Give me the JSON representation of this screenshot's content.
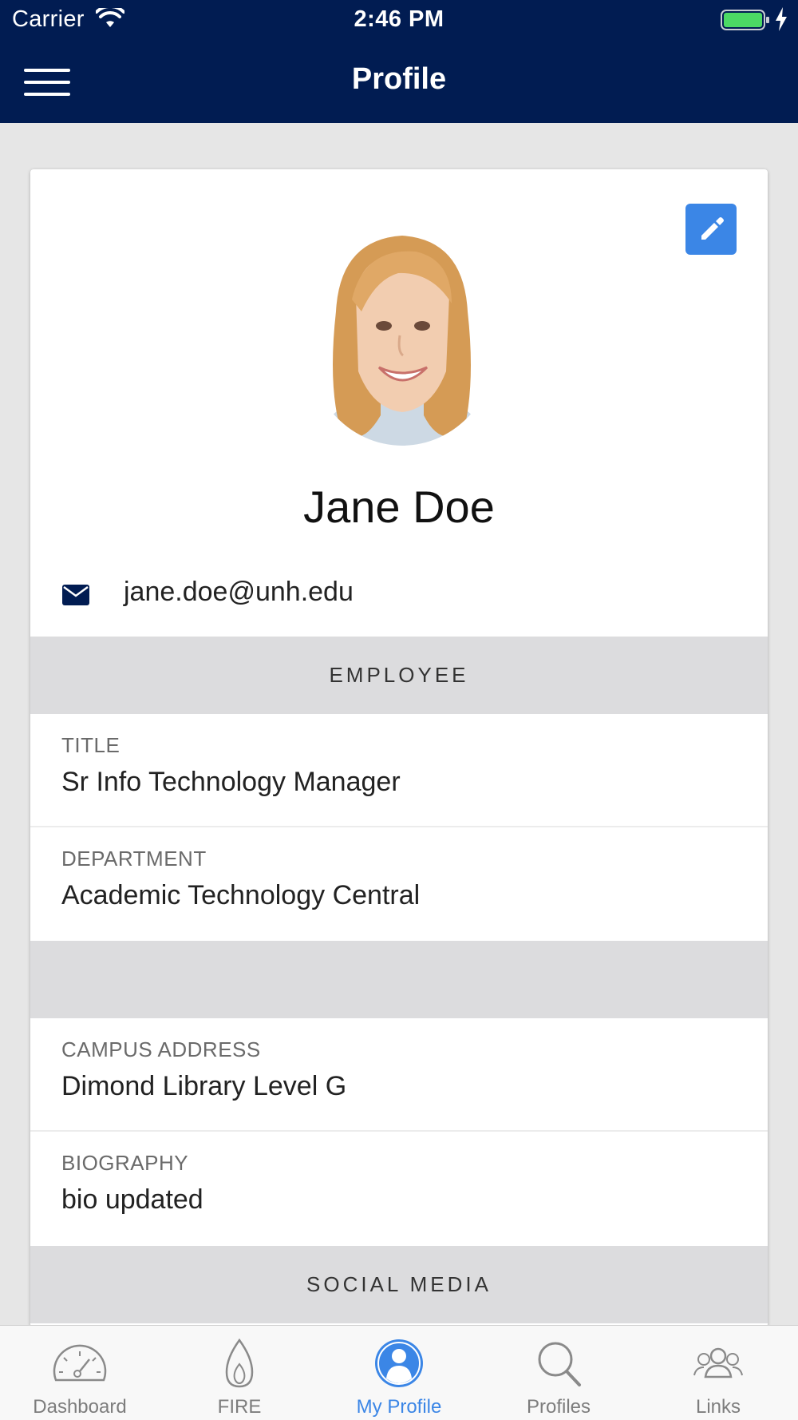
{
  "status_bar": {
    "carrier": "Carrier",
    "time": "2:46 PM"
  },
  "nav": {
    "title": "Profile"
  },
  "profile": {
    "name": "Jane Doe",
    "email": "jane.doe@unh.edu"
  },
  "sections": {
    "employee_header": "EMPLOYEE",
    "social_header": "SOCIAL MEDIA"
  },
  "fields": {
    "title": {
      "label": "TITLE",
      "value": "Sr Info Technology Manager"
    },
    "department": {
      "label": "DEPARTMENT",
      "value": "Academic Technology Central"
    },
    "campus_address": {
      "label": "CAMPUS ADDRESS",
      "value": "Dimond Library Level G"
    },
    "biography": {
      "label": "BIOGRAPHY",
      "value": "bio updated"
    }
  },
  "tabs": [
    {
      "label": "Dashboard",
      "icon": "dashboard-gauge-icon"
    },
    {
      "label": "FIRE",
      "icon": "flame-icon"
    },
    {
      "label": "My Profile",
      "icon": "user-circle-icon",
      "active": true
    },
    {
      "label": "Profiles",
      "icon": "search-icon"
    },
    {
      "label": "Links",
      "icon": "group-icon"
    }
  ],
  "colors": {
    "nav_bg": "#011c52",
    "accent": "#3b86e6",
    "section_bg": "#dcdcde"
  }
}
